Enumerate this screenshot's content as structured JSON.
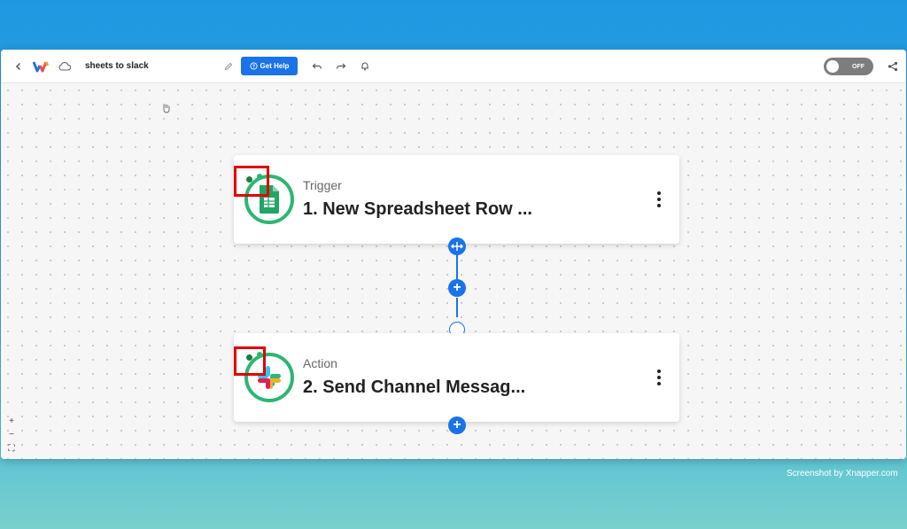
{
  "header": {
    "title": "sheets to slack",
    "help_label": "Get Help",
    "toggle_label": "OFF"
  },
  "steps": [
    {
      "type": "Trigger",
      "name": "1. New Spreadsheet Row ...",
      "icon": "google-sheets-icon"
    },
    {
      "type": "Action",
      "name": "2. Send Channel Messag...",
      "icon": "slack-icon"
    }
  ],
  "zoom_controls": {
    "in": "+",
    "out": "−",
    "fit": "⛶"
  },
  "watermark": "Screenshot by Xnapper.com",
  "colors": {
    "accent": "#1a73e8",
    "success": "#2bb673",
    "highlight": "#e00000"
  }
}
